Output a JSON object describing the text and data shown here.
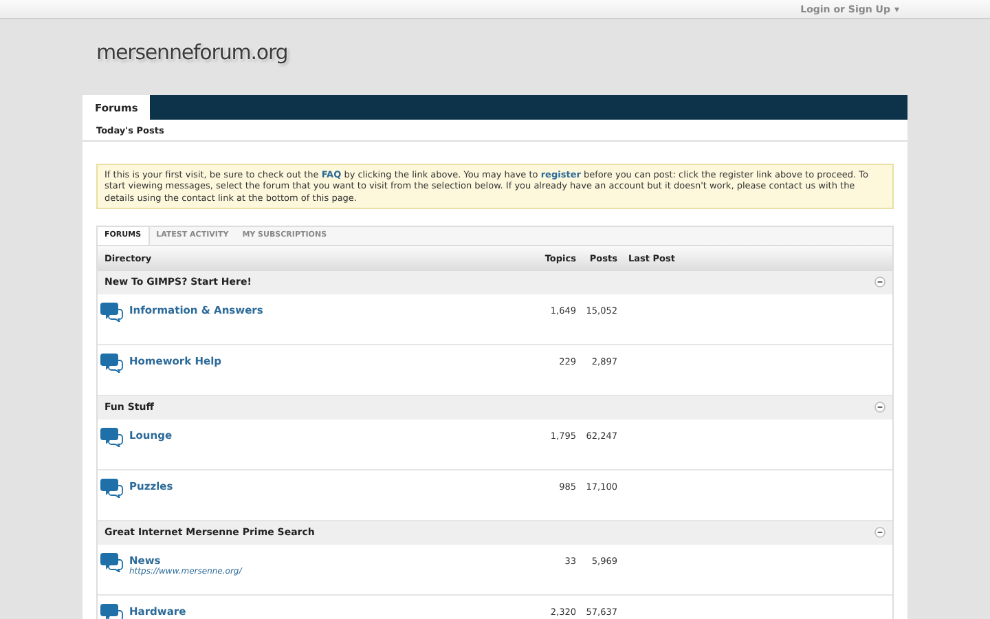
{
  "top_bar": {
    "login": "Login or Sign Up",
    "caret": "▾"
  },
  "logo": "mersenneforum.org",
  "nav": {
    "tabs": [
      {
        "label": "Forums",
        "selected": true
      }
    ],
    "subnav": [
      "Today's Posts"
    ]
  },
  "notice": [
    {
      "kind": "text",
      "text": "If this is your first visit, be sure to check out the "
    },
    {
      "kind": "link",
      "text": "FAQ"
    },
    {
      "kind": "text",
      "text": " by clicking the link above. You may have to "
    },
    {
      "kind": "link",
      "text": "register"
    },
    {
      "kind": "text",
      "text": " before you can post: click the register link above to proceed. To start viewing messages, select the forum that you want to visit from the selection below. If you already have an account but it doesn't work, please contact us with the details using the contact link at the bottom of this page."
    }
  ],
  "tabs": [
    {
      "label": "FORUMS",
      "selected": true
    },
    {
      "label": "LATEST ACTIVITY",
      "selected": false
    },
    {
      "label": "MY SUBSCRIPTIONS",
      "selected": false
    }
  ],
  "columns": [
    "Directory",
    "Topics",
    "Posts",
    "Last Post"
  ],
  "categories": [
    {
      "title": "New To GIMPS? Start Here!",
      "forums": [
        {
          "name": "Information & Answers",
          "topics": "1,649",
          "posts": "15,052"
        },
        {
          "name": "Homework Help",
          "topics": "229",
          "posts": "2,897"
        }
      ]
    },
    {
      "title": "Fun Stuff",
      "forums": [
        {
          "name": "Lounge",
          "topics": "1,795",
          "posts": "62,247"
        },
        {
          "name": "Puzzles",
          "topics": "985",
          "posts": "17,100"
        }
      ]
    },
    {
      "title": "Great Internet Mersenne Prime Search",
      "forums": [
        {
          "name": "News",
          "url": "https://www.mersenne.org/",
          "topics": "33",
          "posts": "5,969"
        },
        {
          "name": "Hardware",
          "topics": "2,320",
          "posts": "57,637"
        }
      ]
    }
  ]
}
